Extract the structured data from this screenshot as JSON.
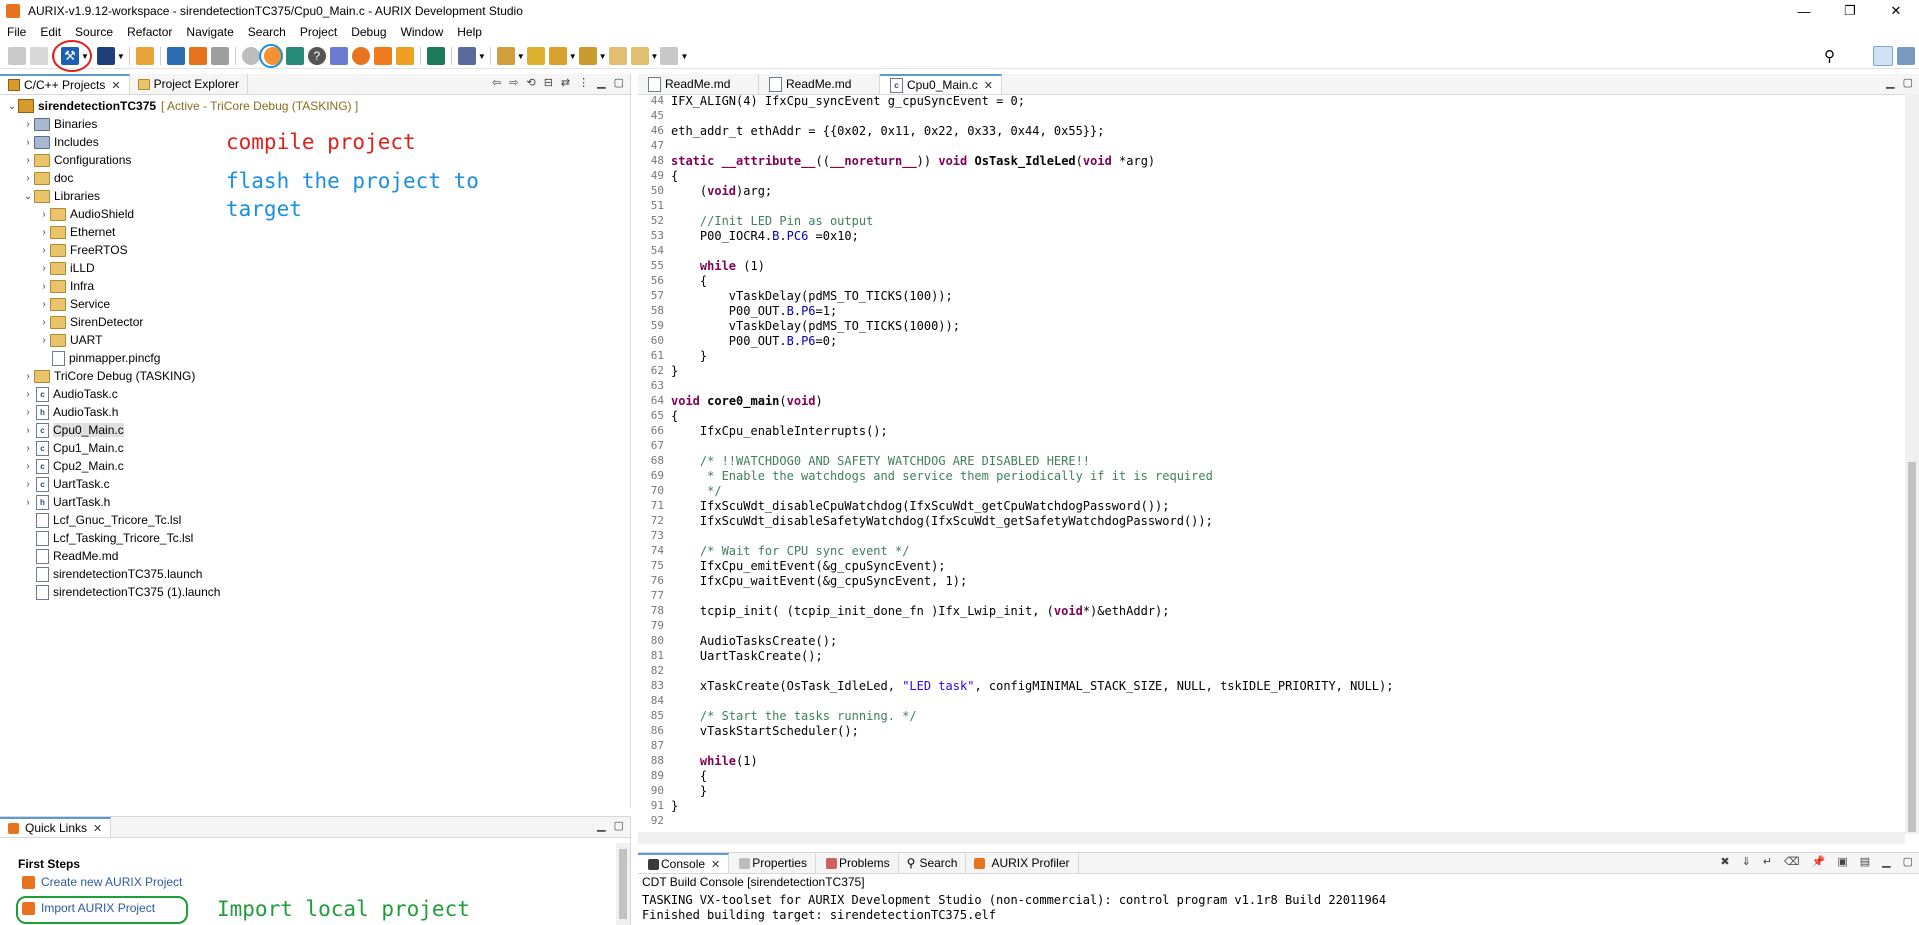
{
  "window": {
    "title": "AURIX-v1.9.12-workspace - sirendetectionTC375/Cpu0_Main.c - AURIX Development Studio",
    "controls": [
      "—",
      "❐",
      "✕"
    ]
  },
  "menu": [
    "File",
    "Edit",
    "Source",
    "Refactor",
    "Navigate",
    "Search",
    "Project",
    "Debug",
    "Window",
    "Help"
  ],
  "left_panel": {
    "tabs": [
      "C/C++ Projects",
      "Project Explorer"
    ],
    "project": "sirendetectionTC375",
    "project_status": "[ Active - TriCore Debug (TASKING) ]",
    "tree": [
      {
        "label": "Binaries",
        "indent": 1,
        "type": "special",
        "arrow": "›"
      },
      {
        "label": "Includes",
        "indent": 1,
        "type": "special",
        "arrow": "›"
      },
      {
        "label": "Configurations",
        "indent": 1,
        "type": "folder",
        "arrow": "›"
      },
      {
        "label": "doc",
        "indent": 1,
        "type": "folder",
        "arrow": "›"
      },
      {
        "label": "Libraries",
        "indent": 1,
        "type": "folder",
        "arrow": "⌄"
      },
      {
        "label": "AudioShield",
        "indent": 2,
        "type": "folder",
        "arrow": "›"
      },
      {
        "label": "Ethernet",
        "indent": 2,
        "type": "folder",
        "arrow": "›"
      },
      {
        "label": "FreeRTOS",
        "indent": 2,
        "type": "folder",
        "arrow": "›"
      },
      {
        "label": "iLLD",
        "indent": 2,
        "type": "folder",
        "arrow": "›"
      },
      {
        "label": "Infra",
        "indent": 2,
        "type": "folder",
        "arrow": "›"
      },
      {
        "label": "Service",
        "indent": 2,
        "type": "folder",
        "arrow": "›"
      },
      {
        "label": "SirenDetector",
        "indent": 2,
        "type": "folder",
        "arrow": "›"
      },
      {
        "label": "UART",
        "indent": 2,
        "type": "folder",
        "arrow": "›"
      },
      {
        "label": "pinmapper.pincfg",
        "indent": 2,
        "type": "file",
        "arrow": ""
      },
      {
        "label": "TriCore Debug (TASKING)",
        "indent": 1,
        "type": "folder",
        "arrow": "›"
      },
      {
        "label": "AudioTask.c",
        "indent": 1,
        "type": "cfile",
        "arrow": "›"
      },
      {
        "label": "AudioTask.h",
        "indent": 1,
        "type": "hfile",
        "arrow": "›"
      },
      {
        "label": "Cpu0_Main.c",
        "indent": 1,
        "type": "cfile",
        "arrow": "›",
        "selected": true
      },
      {
        "label": "Cpu1_Main.c",
        "indent": 1,
        "type": "cfile",
        "arrow": "›"
      },
      {
        "label": "Cpu2_Main.c",
        "indent": 1,
        "type": "cfile",
        "arrow": "›"
      },
      {
        "label": "UartTask.c",
        "indent": 1,
        "type": "cfile",
        "arrow": "›"
      },
      {
        "label": "UartTask.h",
        "indent": 1,
        "type": "hfile",
        "arrow": "›"
      },
      {
        "label": "Lcf_Gnuc_Tricore_Tc.lsl",
        "indent": 1,
        "type": "file",
        "arrow": ""
      },
      {
        "label": "Lcf_Tasking_Tricore_Tc.lsl",
        "indent": 1,
        "type": "file",
        "arrow": ""
      },
      {
        "label": "ReadMe.md",
        "indent": 1,
        "type": "file",
        "arrow": ""
      },
      {
        "label": "sirendetectionTC375.launch",
        "indent": 1,
        "type": "file",
        "arrow": ""
      },
      {
        "label": "sirendetectionTC375 (1).launch",
        "indent": 1,
        "type": "file",
        "arrow": ""
      }
    ]
  },
  "annotations": {
    "compile": "compile project",
    "flash": "flash the project to\ntarget",
    "import": "Import local project",
    "compile_color": "#e0201a",
    "flash_color": "#1a8fe0",
    "import_color": "#1e9e3a"
  },
  "quick_links": {
    "tab": "Quick Links",
    "section": "First Steps",
    "links": [
      "Create new AURIX Project",
      "Import AURIX Project"
    ]
  },
  "editor": {
    "tabs": [
      "ReadMe.md",
      "ReadMe.md",
      "Cpu0_Main.c"
    ],
    "active_tab": 2
  },
  "console": {
    "tabs": [
      "Console",
      "Properties",
      "Problems",
      "Search",
      "AURIX Profiler"
    ],
    "header": "CDT Build Console [sirendetectionTC375]",
    "lines": [
      "TASKING VX-toolset for AURIX Development Studio (non-commercial): control program v1.1r8 Build 22011964",
      "Finished building target: sirendetectionTC375.elf"
    ]
  }
}
